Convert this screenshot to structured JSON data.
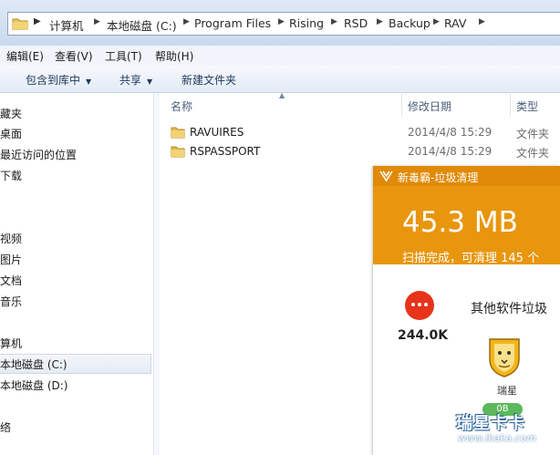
{
  "address": {
    "breadcrumbs": [
      {
        "label": "计算机"
      },
      {
        "label": "本地磁盘 (C:)"
      },
      {
        "label": "Program Files"
      },
      {
        "label": "Rising"
      },
      {
        "label": "RSD"
      },
      {
        "label": "Backup"
      },
      {
        "label": "RAV"
      }
    ]
  },
  "menubar": {
    "edit": "编辑(E)",
    "view": "查看(V)",
    "tools": "工具(T)",
    "help": "帮助(H)"
  },
  "toolbar": {
    "include_library": "包含到库中",
    "share": "共享",
    "new_folder": "新建文件夹"
  },
  "nav": {
    "favorites": "藏夹",
    "desktop": "桌面",
    "recent": "最近访问的位置",
    "downloads": "下载",
    "videos": "视频",
    "pictures": "图片",
    "documents": "文档",
    "music": "音乐",
    "computer": "算机",
    "drive_c": "本地磁盘 (C:)",
    "drive_d": "本地磁盘 (D:)",
    "network": "络"
  },
  "columns": {
    "name": "名称",
    "modified": "修改日期",
    "type": "类型"
  },
  "files": [
    {
      "name": "RAVUIRES",
      "modified": "2014/4/8 15:29",
      "type": "文件夹"
    },
    {
      "name": "RSPASSPORT",
      "modified": "2014/4/8 15:29",
      "type": "文件夹"
    }
  ],
  "popup": {
    "title": "新毒霸-垃圾清理",
    "size": "45.3 MB",
    "status": "扫描完成，可清理 145 个",
    "category": "其他软件垃圾",
    "total": "244.0K",
    "app_name": "瑞星",
    "app_size": "0B",
    "colors": {
      "titlebar": "#e08a07",
      "header": "#e8960e",
      "badge": "#5cb85c",
      "more": "#e8331b"
    }
  },
  "watermark": {
    "brand": "瑞星卡卡",
    "url": "www.ikaka.com"
  }
}
